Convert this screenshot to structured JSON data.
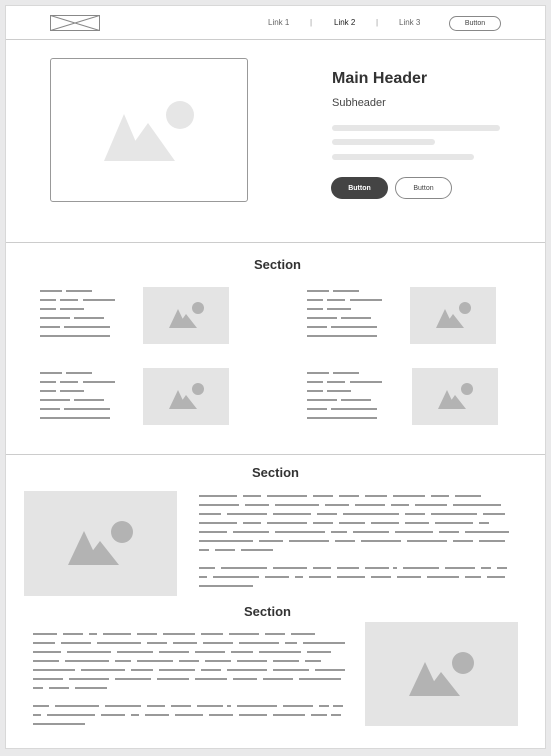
{
  "nav": {
    "links": [
      "Link 1",
      "Link 2",
      "Link 3"
    ],
    "button_label": "Button"
  },
  "hero": {
    "title": "Main Header",
    "subtitle": "Subheader",
    "primary_button": "Button",
    "secondary_button": "Button"
  },
  "sections": [
    "Section",
    "Section",
    "Section"
  ],
  "colors": {
    "page_bg": "#ffffff",
    "outer_bg": "#e9e9ea",
    "dark_button": "#444444",
    "placeholder": "#e4e4e4",
    "text_line": "#999999"
  }
}
